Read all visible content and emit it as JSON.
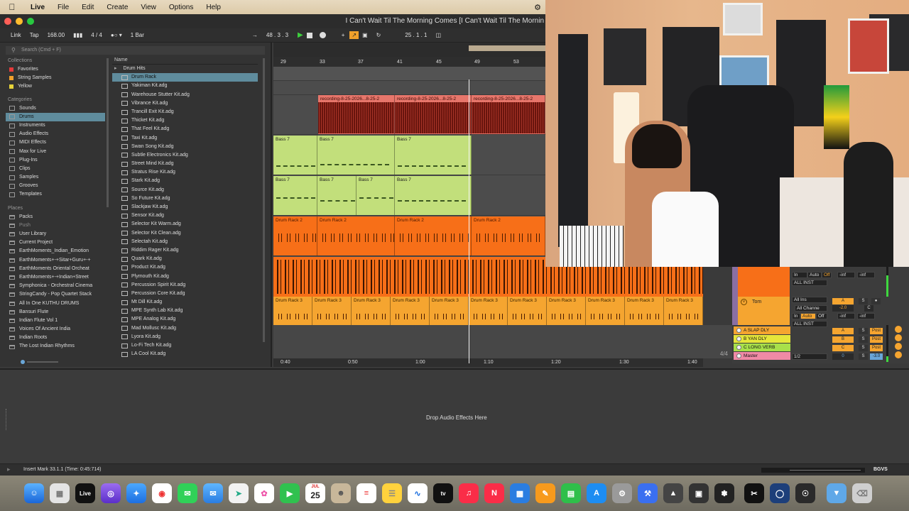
{
  "menubar": {
    "app": "Live",
    "items": [
      "File",
      "Edit",
      "Create",
      "View",
      "Options",
      "Help"
    ]
  },
  "window": {
    "title": "I Can't Wait Til The Morning Comes  [I Can't Wait Til The Mornin"
  },
  "control_bar": {
    "link": "Link",
    "tap": "Tap",
    "tempo": "168.00",
    "signature": "4 / 4",
    "quantize": "1 Bar",
    "position": "48 .  3 .  3",
    "loop_start": "25 .  1 .  1"
  },
  "browser": {
    "search_placeholder": "Search (Cmd + F)",
    "collections_title": "Collections",
    "collections": [
      {
        "label": "Favorites",
        "color": "#e53b3b"
      },
      {
        "label": "String Samples",
        "color": "#f0a02b"
      },
      {
        "label": "Yellow",
        "color": "#e6d33a"
      }
    ],
    "categories_title": "Categories",
    "categories": [
      "Sounds",
      "Drums",
      "Instruments",
      "Audio Effects",
      "MIDI Effects",
      "Max for Live",
      "Plug-Ins",
      "Clips",
      "Samples",
      "Grooves",
      "Templates"
    ],
    "selected_category": "Drums",
    "places_title": "Places",
    "places": [
      "Packs",
      "Push",
      "User Library",
      "Current Project",
      "EarthMoments_Indian_Emotion",
      "EarthMoments+-+Sitar+Guru+-+",
      "EarthMoments Oriental Orcheat",
      "EarthMoments+-+Indian+Street",
      "Symphonica - Orchestral Cinema",
      "StringCandy - Pop Quartet Stack",
      "All In One KUTHU DRUMS",
      "Bansuri Flute",
      "Indian Flute Vol 1",
      "Voices Of Ancient India",
      "Indian Roots",
      "The Lost Indian Rhythms"
    ],
    "name_header": "Name",
    "folder": "Drum Hits",
    "selected_item": "Drum Rack",
    "files": [
      "Yakiman Kit.adg",
      "Warehouse Stutter Kit.adg",
      "Vibrance Kit.adg",
      "Trancill Exit Kit.adg",
      "Thicket Kit.adg",
      "That Feel Kit.adg",
      "Taxi Kit.adg",
      "Swan Song Kit.adg",
      "Subtle Electronics Kit.adg",
      "Street Mind Kit.adg",
      "Stratus Rise Kit.adg",
      "Stark Kit.adg",
      "Source Kit.adg",
      "So Future Kit.adg",
      "Slackjaw Kit.adg",
      "Sensor Kit.adg",
      "Selector Kit Warm.adg",
      "Selector Kit Clean.adg",
      "Selectah Kit.adg",
      "Riddim Rager Kit.adg",
      "Quark Kit.adg",
      "Product Kit.adg",
      "Plymouth Kit.adg",
      "Percussion Spirit Kit.adg",
      "Percussion Core Kit.adg",
      "Mt Dill Kit.adg",
      "MPE Synth Lab Kit.adg",
      "MPE Analog Kit.adg",
      "Mad Mollusc Kit.adg",
      "Lyora Kit.adg",
      "Lo-Fi Tech Kit.adg",
      "LA Cool Kit.adg"
    ]
  },
  "arrangement": {
    "bars": [
      "29",
      "33",
      "37",
      "41",
      "45",
      "49",
      "53"
    ],
    "audio_clip": "recording-8-25-2026...8-25-2",
    "bass_clip": "Bass 7",
    "drum_rack_2": "Drum Rack 2",
    "drum_rack_3": "Drum Rack 3",
    "times": [
      "0:40",
      "0:50",
      "1:00",
      "1:10",
      "1:20",
      "1:30",
      "1:40"
    ],
    "page": "4/4"
  },
  "mixer": {
    "tracks": [
      {
        "label": "Tom",
        "color": "#f5a530"
      },
      {
        "label": "A SLAP DLY",
        "color": "#f5a530"
      },
      {
        "label": "B YAN DLY",
        "color": "#e6e63a"
      },
      {
        "label": "C LONG VERB",
        "color": "#a8e04a"
      },
      {
        "label": "Master",
        "color": "#f08aa6"
      }
    ],
    "input_type": "All Ins",
    "input_channel": "All Channe",
    "all_inst": "ALL INST",
    "in_label": "In",
    "auto_label": "Auto",
    "off_label": "Off",
    "inf": "-inf",
    "vol_tom": "-2.0",
    "vol_master": "-3.0",
    "master_ratio": "1/2",
    "s": "S",
    "post": "Post",
    "sends": [
      "A",
      "B",
      "C"
    ],
    "master_val": "0"
  },
  "device": {
    "drop_text": "Drop Audio Effects Here"
  },
  "status": {
    "text": "Insert Mark 33.1.1 (Time: 0:45:714)",
    "user": "BGVS"
  },
  "dock": {
    "calendar_day": "25",
    "calendar_month": "JUL",
    "live_label": "Live"
  },
  "icons": {
    "apple": "apple-icon",
    "search": "search-icon",
    "play": "play-icon",
    "stop": "stop-icon",
    "record": "record-icon"
  }
}
